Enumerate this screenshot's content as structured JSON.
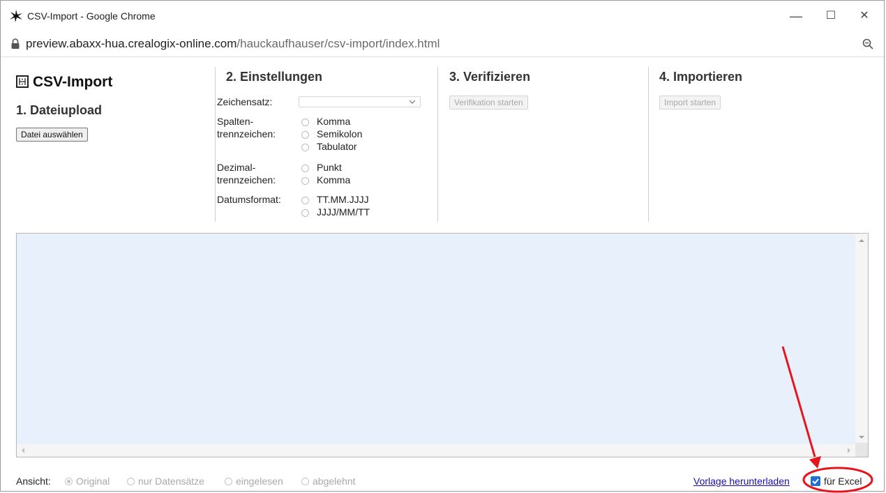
{
  "window": {
    "title": "CSV-Import - Google Chrome",
    "minimize": "—",
    "maximize": "☐",
    "close": "✕"
  },
  "address": {
    "domain": "preview.abaxx-hua.crealogix-online.com",
    "path": "/hauckaufhauser/csv-import/index.html"
  },
  "app": {
    "title": "CSV-Import",
    "step1": {
      "heading": "1. Dateiupload",
      "button": "Datei auswählen"
    },
    "step2": {
      "heading": "2. Einstellungen",
      "charset_label": "Zeichensatz:",
      "charset_value": "",
      "separator_label_1": "Spalten-",
      "separator_label_2": "trennzeichen:",
      "separator_options": [
        "Komma",
        "Semikolon",
        "Tabulator"
      ],
      "decimal_label_1": "Dezimal-",
      "decimal_label_2": "trennzeichen:",
      "decimal_options": [
        "Punkt",
        "Komma"
      ],
      "date_label": "Datumsformat:",
      "date_options": [
        "TT.MM.JJJJ",
        "JJJJ/MM/TT"
      ]
    },
    "step3": {
      "heading": "3. Verifizieren",
      "button": "Verifikation starten"
    },
    "step4": {
      "heading": "4. Importieren",
      "button": "Import starten"
    }
  },
  "footer": {
    "view_label": "Ansicht:",
    "view_options": [
      "Original",
      "nur Datensätze",
      "eingelesen",
      "abgelehnt"
    ],
    "selected_view": "Original",
    "template_link": "Vorlage herunterladen",
    "excel_label": "für Excel",
    "excel_checked": true
  },
  "colors": {
    "grid_background": "#e8f0fb",
    "annotation": "#e8141b",
    "link": "#1a0dab",
    "checkbox": "#1f6fd6"
  }
}
